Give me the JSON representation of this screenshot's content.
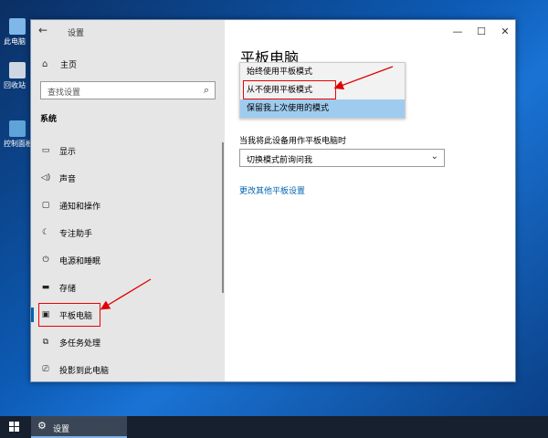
{
  "desktop": {
    "icons": [
      {
        "label": "此电脑"
      },
      {
        "label": "回收站"
      },
      {
        "label": "控制面板"
      }
    ]
  },
  "window": {
    "title": "设置",
    "back_glyph": "←",
    "minimize_glyph": "—",
    "maximize_glyph": "☐",
    "close_glyph": "✕"
  },
  "sidebar": {
    "home_label": "主页",
    "search_placeholder": "查找设置",
    "section_label": "系统",
    "items": [
      {
        "label": "显示",
        "icon": "monitor-icon",
        "glyph": "▭"
      },
      {
        "label": "声音",
        "icon": "speaker-icon",
        "glyph": "◁)"
      },
      {
        "label": "通知和操作",
        "icon": "notification-icon",
        "glyph": "▢"
      },
      {
        "label": "专注助手",
        "icon": "moon-icon",
        "glyph": "☾"
      },
      {
        "label": "电源和睡眠",
        "icon": "power-icon",
        "glyph": "⏻"
      },
      {
        "label": "存储",
        "icon": "storage-icon",
        "glyph": "▬"
      },
      {
        "label": "平板电脑",
        "icon": "tablet-icon",
        "glyph": "▣",
        "selected": true
      },
      {
        "label": "多任务处理",
        "icon": "multitask-icon",
        "glyph": "⧉"
      },
      {
        "label": "投影到此电脑",
        "icon": "project-icon",
        "glyph": "⎚"
      }
    ]
  },
  "main": {
    "page_title": "平板电脑",
    "dropdown_options": [
      {
        "label": "始终使用平板模式"
      },
      {
        "label": "从不使用平板模式"
      },
      {
        "label": "保留我上次使用的模式",
        "selected": true
      }
    ],
    "signin_label": "当我将此设备用作平板电脑时",
    "signin_select_value": "切换模式前询问我",
    "link_label": "更改其他平板设置"
  },
  "taskbar": {
    "app_label": "设置"
  },
  "colors": {
    "accent": "#0063b1",
    "highlight_red": "#e00000",
    "selection": "#9fccee"
  }
}
